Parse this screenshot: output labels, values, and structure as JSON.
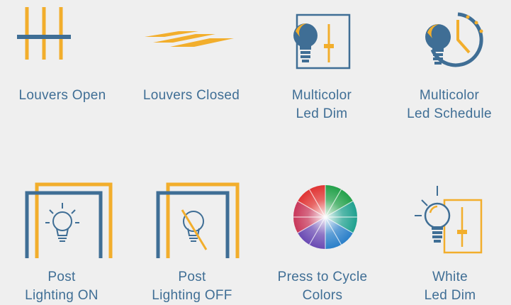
{
  "colors": {
    "blue": "#3f6e95",
    "gold": "#f2ae2c",
    "background": "#efefef"
  },
  "tiles": [
    {
      "icon": "louvers-open-icon",
      "label": "Louvers Open"
    },
    {
      "icon": "louvers-closed-icon",
      "label": "Louvers Closed"
    },
    {
      "icon": "bulb-dimmer-icon",
      "label": "Multicolor\nLed Dim"
    },
    {
      "icon": "bulb-clock-icon",
      "label": "Multicolor\nLed Schedule"
    },
    {
      "icon": "post-lighting-on-icon",
      "label": "Post\nLighting ON"
    },
    {
      "icon": "post-lighting-off-icon",
      "label": "Post\nLighting OFF"
    },
    {
      "icon": "color-wheel-icon",
      "label": "Press to Cycle\nColors"
    },
    {
      "icon": "white-bulb-dimmer-icon",
      "label": "White\nLed Dim"
    }
  ]
}
